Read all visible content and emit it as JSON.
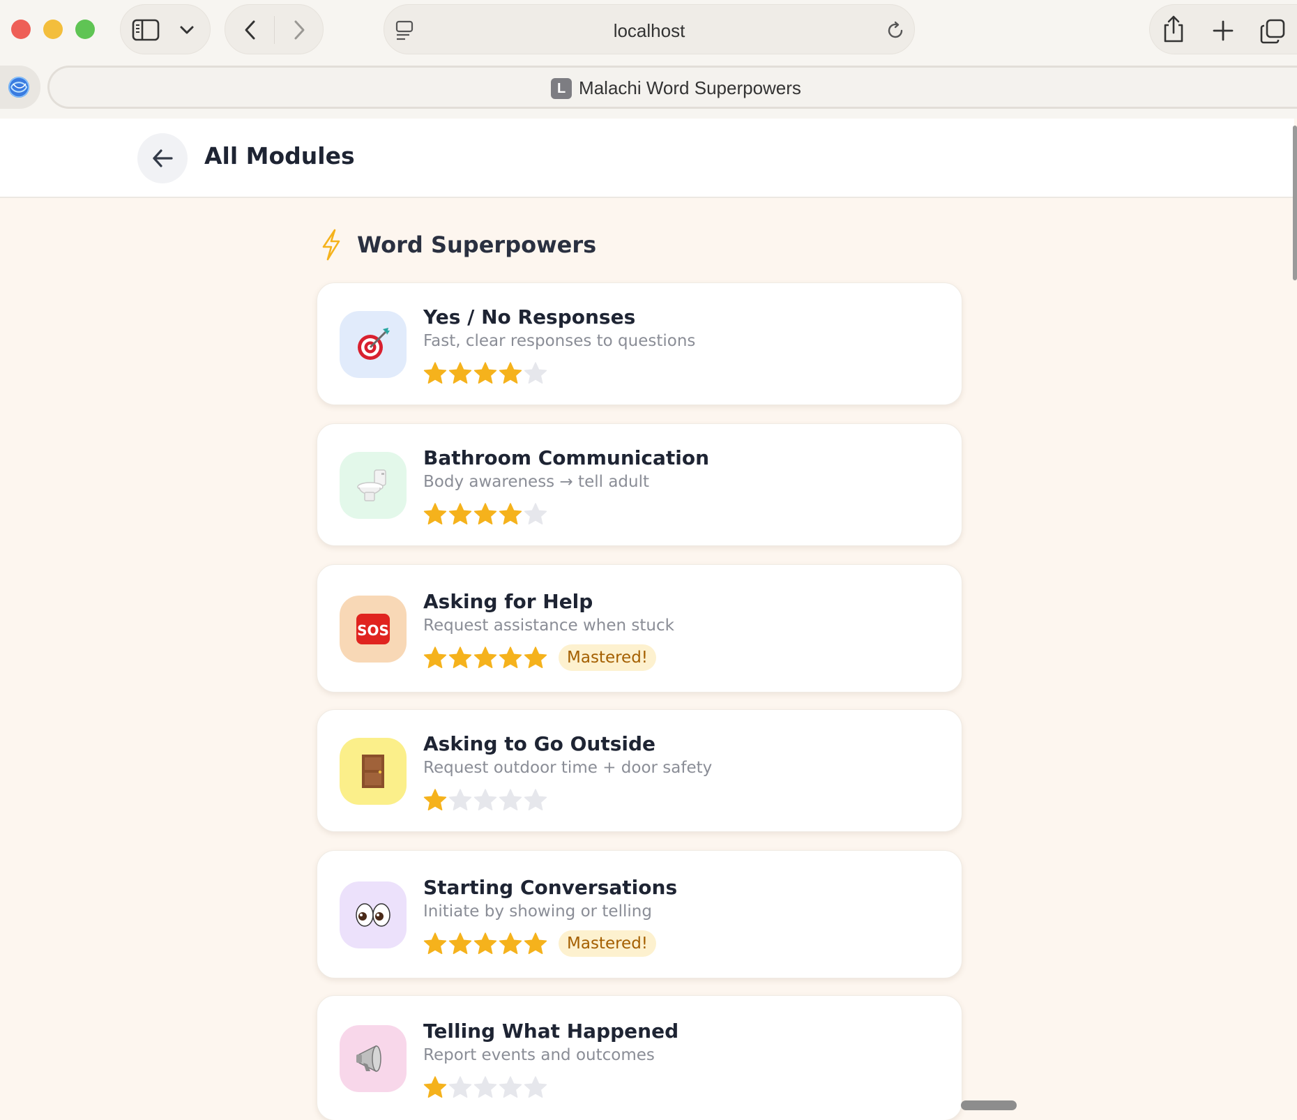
{
  "browser": {
    "address": "localhost",
    "tab_favicon_letter": "L",
    "tab_title": "Malachi Word Superpowers"
  },
  "header": {
    "title": "All Modules"
  },
  "section": {
    "title": "Word Superpowers",
    "icon": "lightning-icon",
    "accent_color": "#f5b21c"
  },
  "modules": [
    {
      "title": "Yes / No Responses",
      "description": "Fast, clear responses to questions",
      "icon": "target-icon",
      "icon_bg": "#e1ebfb",
      "stars_filled": 4,
      "stars_total": 5,
      "badge": ""
    },
    {
      "title": "Bathroom Communication",
      "description": "Body awareness → tell adult",
      "icon": "toilet-icon",
      "icon_bg": "#e3f8ea",
      "stars_filled": 4,
      "stars_total": 5,
      "badge": ""
    },
    {
      "title": "Asking for Help",
      "description": "Request assistance when stuck",
      "icon": "sos-icon",
      "icon_bg": "#f8d8b6",
      "stars_filled": 5,
      "stars_total": 5,
      "badge": "Mastered!"
    },
    {
      "title": "Asking to Go Outside",
      "description": "Request outdoor time + door safety",
      "icon": "door-icon",
      "icon_bg": "#fbef8a",
      "stars_filled": 1,
      "stars_total": 5,
      "badge": ""
    },
    {
      "title": "Starting Conversations",
      "description": "Initiate by showing or telling",
      "icon": "eyes-icon",
      "icon_bg": "#ece1fb",
      "stars_filled": 5,
      "stars_total": 5,
      "badge": "Mastered!"
    },
    {
      "title": "Telling What Happened",
      "description": "Report events and outcomes",
      "icon": "megaphone-icon",
      "icon_bg": "#f8d7ea",
      "stars_filled": 1,
      "stars_total": 5,
      "badge": ""
    }
  ],
  "colors": {
    "star_filled": "#f5b21c",
    "star_empty": "#e6e7ec",
    "badge_bg": "#fdf1cf",
    "badge_text": "#a45f00"
  }
}
